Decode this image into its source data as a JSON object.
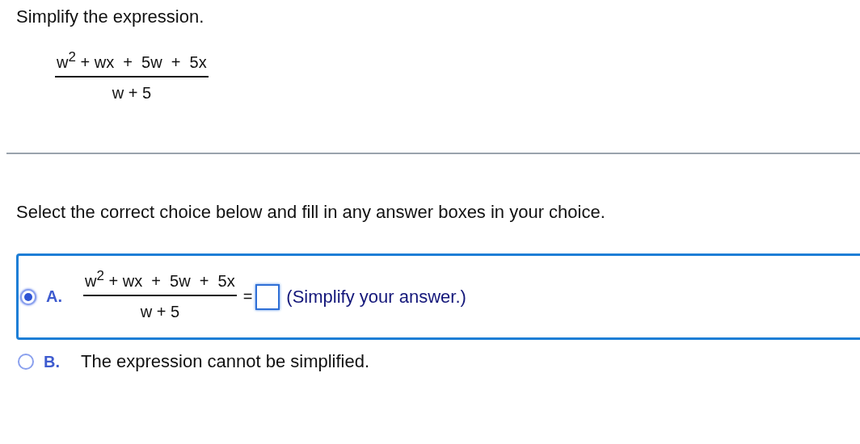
{
  "prompt": "Simplify the expression.",
  "expression": {
    "numerator": "w$^{2}$ + wx  +  5w  +  5x",
    "denominator": "w + 5"
  },
  "instruction": "Select the correct choice below and fill in any answer boxes in your choice.",
  "choices": [
    {
      "kind": "equation",
      "letter": "A.",
      "selected": true,
      "numerator": "w$^{2}$ + wx  +  5w  +  5x",
      "denominator": "w + 5",
      "equals": "=",
      "hint": "(Simplify your answer.)"
    },
    {
      "kind": "text",
      "letter": "B.",
      "selected": false,
      "text": "The expression cannot be simplified."
    }
  ]
}
